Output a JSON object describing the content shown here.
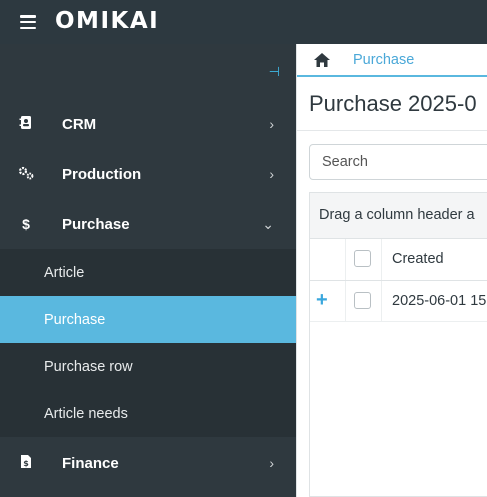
{
  "app": {
    "logo_text": "OMIKAI"
  },
  "sidebar": {
    "items": [
      {
        "label": "CRM",
        "icon": "address-book-icon"
      },
      {
        "label": "Production",
        "icon": "gears-icon"
      },
      {
        "label": "Purchase",
        "icon": "dollar-icon",
        "expanded": true
      },
      {
        "label": "Finance",
        "icon": "file-invoice-icon"
      }
    ],
    "purchase_subitems": [
      {
        "label": "Article"
      },
      {
        "label": "Purchase",
        "active": true
      },
      {
        "label": "Purchase row"
      },
      {
        "label": "Article needs"
      }
    ]
  },
  "breadcrumb": {
    "current": "Purchase"
  },
  "page": {
    "title": "Purchase 2025-0"
  },
  "search": {
    "placeholder": "Search"
  },
  "grid": {
    "group_panel_text": "Drag a column header a",
    "columns": [
      "Created"
    ],
    "rows": [
      {
        "created": "2025-06-01 15:"
      }
    ]
  },
  "colors": {
    "topbar": "#2d3940",
    "sidebar": "#2f393f",
    "submenu": "#283136",
    "active": "#5ab8df",
    "accent": "#3fb8e6"
  }
}
